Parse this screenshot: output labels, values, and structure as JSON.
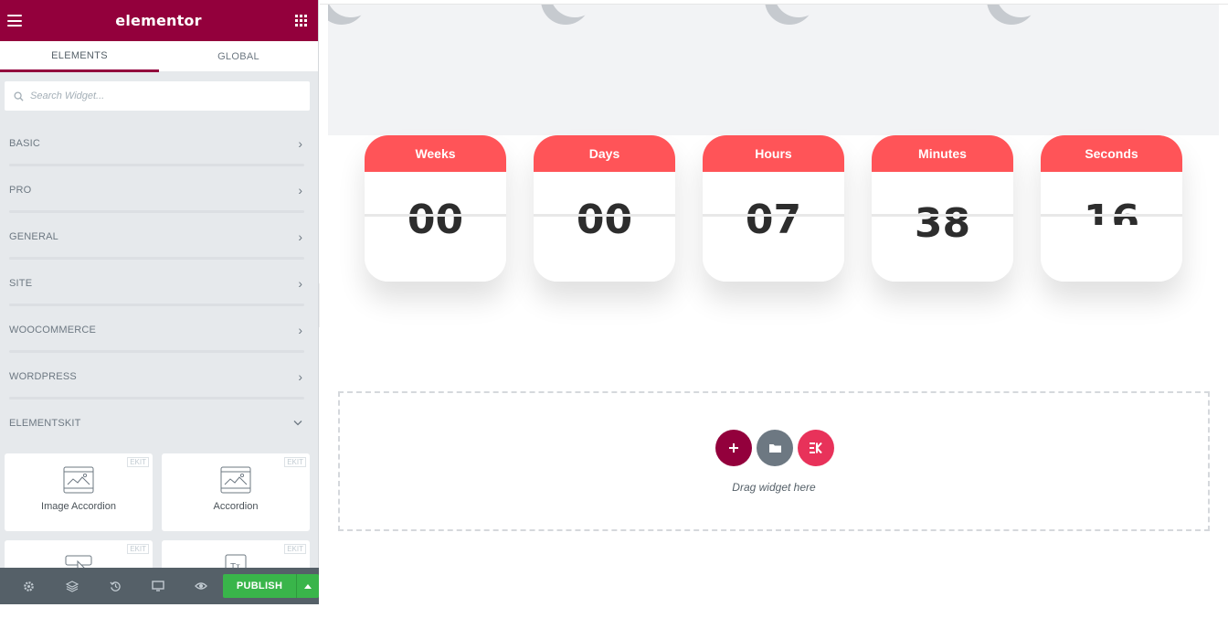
{
  "app": {
    "brand": "elementor"
  },
  "tabs": [
    {
      "label": "ELEMENTS",
      "active": true
    },
    {
      "label": "GLOBAL",
      "active": false
    }
  ],
  "search": {
    "placeholder": "Search Widget..."
  },
  "categories": [
    {
      "label": "BASIC",
      "expanded": false
    },
    {
      "label": "PRO",
      "expanded": false
    },
    {
      "label": "GENERAL",
      "expanded": false
    },
    {
      "label": "SITE",
      "expanded": false
    },
    {
      "label": "WOOCOMMERCE",
      "expanded": false
    },
    {
      "label": "WORDPRESS",
      "expanded": false
    },
    {
      "label": "ELEMENTSKIT",
      "expanded": true
    }
  ],
  "widgets": [
    {
      "label": "Image Accordion",
      "badge": "EKIT",
      "icon": "image-accordion-icon"
    },
    {
      "label": "Accordion",
      "badge": "EKIT",
      "icon": "accordion-icon"
    },
    {
      "label": "",
      "badge": "EKIT",
      "icon": "button-cursor-icon"
    },
    {
      "label": "",
      "badge": "EKIT",
      "icon": "text-tt-icon"
    }
  ],
  "footer": {
    "publish_label": "PUBLISH",
    "icons": [
      "settings-icon",
      "layers-icon",
      "history-icon",
      "responsive-icon",
      "preview-icon"
    ]
  },
  "countdown": [
    {
      "label": "Weeks",
      "value": "00"
    },
    {
      "label": "Days",
      "value": "00"
    },
    {
      "label": "Hours",
      "value": "07"
    },
    {
      "label": "Minutes",
      "value": "38"
    },
    {
      "label": "Seconds",
      "value": "16"
    }
  ],
  "dropzone": {
    "text": "Drag widget here"
  },
  "colors": {
    "brand": "#93003c",
    "countdown_header": "#ff5458",
    "publish": "#39b54a",
    "ekit_button": "#e8325a"
  }
}
